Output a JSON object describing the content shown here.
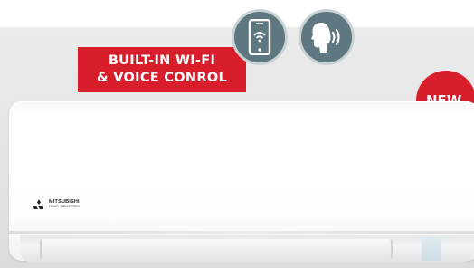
{
  "badge": {
    "line1": "BUILT-IN WI-FI",
    "line2": "& VOICE CONROL"
  },
  "new_badge": "NEW",
  "icons": {
    "phone": "smartphone-wifi-icon",
    "voice": "voice-control-icon",
    "brand": "mitsubishi-logo-icon"
  },
  "brand": {
    "line1": "MITSUBISHI",
    "line2": "HEAVY INDUSTRIES"
  },
  "colors": {
    "red": "#d81e2a",
    "icon_bg": "#5f7780",
    "unit": "#ffffff"
  }
}
